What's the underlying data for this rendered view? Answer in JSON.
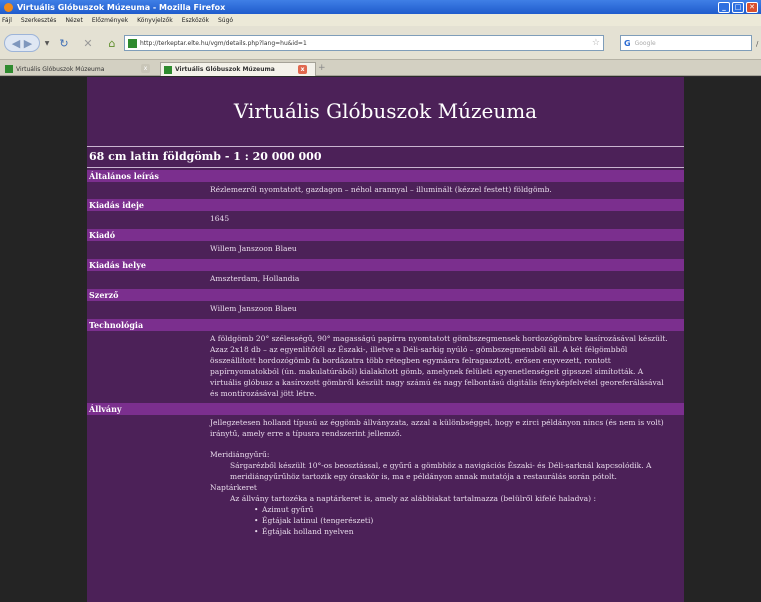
{
  "window": {
    "title": "Virtuális Glóbuszok Múzeuma - Mozilla Firefox"
  },
  "menu": [
    "Fájl",
    "Szerkesztés",
    "Nézet",
    "Előzmények",
    "Könyvjelzők",
    "Eszközök",
    "Súgó"
  ],
  "navbar": {
    "url": "http://terkeptar.elte.hu/vgm/details.php?lang=hu&id=1",
    "search_placeholder": "Google"
  },
  "tabs": [
    {
      "label": "Virtuális Glóbuszok Múzeuma"
    },
    {
      "label": "Virtuális Glóbuszok Múzeuma"
    }
  ],
  "page": {
    "site_title": "Virtuális Glóbuszok Múzeuma",
    "item_title": "68 cm latin földgömb - 1 : 20 000 000",
    "fields": [
      {
        "label": "Általános leírás",
        "value": "Rézlemezről nyomtatott, gazdagon – néhol arannyal – illuminált (kézzel festett) földgömb."
      },
      {
        "label": "Kiadás ideje",
        "value": "1645"
      },
      {
        "label": "Kiadó",
        "value": "Willem Janszoon Blaeu"
      },
      {
        "label": "Kiadás helye",
        "value": "Amszterdam, Hollandia"
      },
      {
        "label": "Szerző",
        "value": "Willem Janszoon Blaeu"
      },
      {
        "label": "Technológia",
        "value": "A földgömb 20° szélességű, 90° magasságú papírra nyomtatott gömbszegmensek hordozógömbre kasírozásával készült. Azaz 2x18 db – az egyenlítőtől az Északi-, illetve a Déli-sarkig nyúló – gömbszegmensből áll. A két félgömbből összeállított hordozógömb fa bordázatra több rétegben egymásra felragasztott, erősen enyvezett, rontott papírnyomatokból (ún. makulatúrából) kialakított gömb, amelynek felületi egyenetlenségeit gipsszel simították. A virtuális glóbusz a kasírozott gömbről készült nagy számú és nagy felbontású digitális fényképfelvétel georeferálásával és montírozásával jött létre."
      },
      {
        "label": "Állvány"
      }
    ],
    "allvany": {
      "intro": "Jellegzetesen holland típusú az éggömb állványzata, azzal a különbséggel, hogy e zirci példányon nincs (és nem is volt) iránytű, amely erre a típusra rendszerint jellemző.",
      "meridian_label": "Meridiángyűrű:",
      "meridian_text": "Sárgarézből készült 10°-os beosztással, e gyűrű a gömbhöz a navigációs Északi- és Déli-sarknál kapcsolódik. A meridiángyűrűhöz tartozik egy óraskör is, ma e példányon annak mutatója a restaurálás során pótolt.",
      "naptar_label": "Naptárkeret",
      "naptar_text": "Az állvány tartozéka a naptárkeret is, amely az alábbiakat tartalmazza (belülről kifelé haladva) :",
      "bullets": [
        "Azimut gyűrű",
        "Égtájak latinul (tengerészeti)",
        "Égtájak holland nyelven"
      ]
    }
  }
}
